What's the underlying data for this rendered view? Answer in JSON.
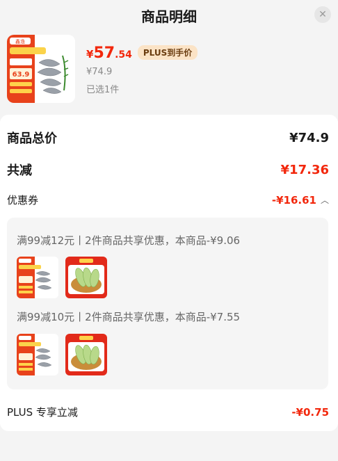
{
  "header": {
    "title": "商品明细",
    "close_icon": "close-icon"
  },
  "product": {
    "price_symbol": "¥",
    "price_int": "57",
    "price_dec": ".54",
    "plus_tag": "PLUS到手价",
    "original_price": "¥74.9",
    "selected_count": "已选1件",
    "thumb_texts": {
      "brand": "鑫渔",
      "banner": "20cm以上大虾",
      "line2": "冷冻大虾",
      "price": "63.9",
      "btn1": "领券再减",
      "btn2": "立即购买"
    }
  },
  "summary": {
    "total_label": "商品总价",
    "total_value": "¥74.9",
    "reduce_label": "共减",
    "reduce_value": "¥17.36",
    "coupon_label": "优惠券",
    "coupon_value": "-¥16.61",
    "plus_label": "PLUS 专享立减",
    "plus_value": "-¥0.75"
  },
  "coupons": [
    {
      "text": "满99减12元丨2件商品共享优惠，本商品-¥9.06"
    },
    {
      "text": "满99减10元丨2件商品共享优惠，本商品-¥7.55"
    }
  ],
  "second_item": {
    "tag": "新鲜生"
  },
  "colors": {
    "accent": "#f2270c",
    "plus_bg": "#fbe3c6"
  }
}
